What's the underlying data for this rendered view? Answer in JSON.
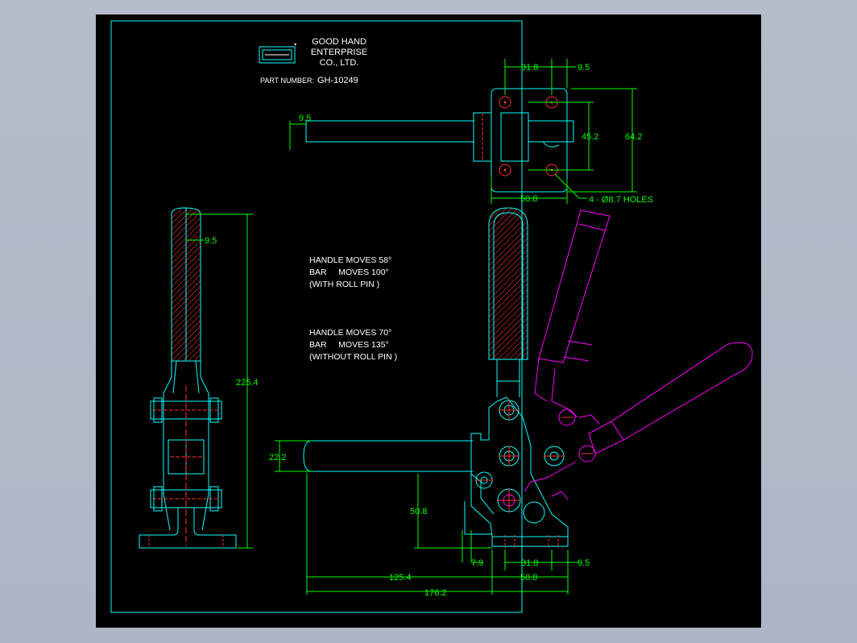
{
  "title_block": {
    "company_line1": "GOOD HAND",
    "company_line2": "ENTERPRISE",
    "company_line3": "CO., LTD.",
    "part_number_label": "PART NUMBER:",
    "part_number": "GH-10249"
  },
  "notes": {
    "with_pin": [
      "HANDLE MOVES 58°",
      "BAR     MOVES 100°",
      "(WITH ROLL PIN )"
    ],
    "without_pin": [
      "HANDLE MOVES 70°",
      "BAR     MOVES 135°",
      "(WITHOUT ROLL PIN )"
    ]
  },
  "dimensions": {
    "top_31_8": "31.8",
    "top_9_5": "9.5",
    "bar_9_5": "9.5",
    "d45_2": "45.2",
    "d64_2": "64.2",
    "d50_8_top": "50.8",
    "holes": "4 - Ø8.7 HOLES",
    "side_9_5": "9.5",
    "side_225_4": "225.4",
    "d22_2": "22.2",
    "d50_8_mid": "50.8",
    "d7_9": "7.9",
    "bot_31_8": "31.8",
    "bot_9_5": "9.5",
    "d125_4": "125.4",
    "d50_8_bot": "50.8",
    "d176_2": "176.2"
  },
  "colors": {
    "background": "#000000",
    "outline": "#00ffff",
    "dimension": "#00ff00",
    "text": "#ffffff",
    "center": "#ff0000",
    "phantom": "#ff00ff",
    "hatch": "#ff3030"
  }
}
